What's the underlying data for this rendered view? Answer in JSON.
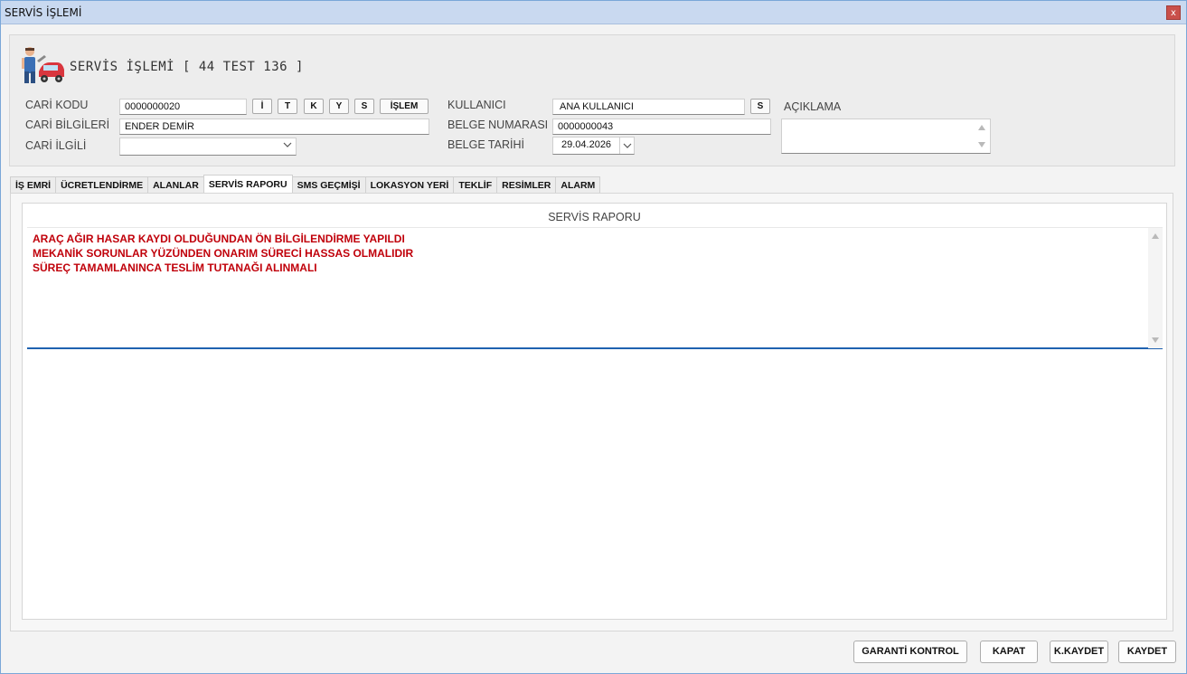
{
  "window": {
    "title": "SERVİS İŞLEMİ",
    "close_label": "x"
  },
  "header": {
    "title": "SERVİS İŞLEMİ [ 44 TEST 136 ]",
    "logo_icon": "mechanic-car-icon"
  },
  "form": {
    "cari_kodu": {
      "label": "CARİ KODU",
      "value": "0000000020"
    },
    "cari_bilgileri": {
      "label": "CARİ BİLGİLERİ",
      "value": "ENDER DEMİR"
    },
    "cari_ilgili": {
      "label": "CARİ İLGİLİ",
      "value": ""
    },
    "cari_buttons": [
      "İ",
      "T",
      "K",
      "Y",
      "S",
      "İŞLEM"
    ],
    "kullanici": {
      "label": "KULLANICI",
      "value": "ANA KULLANICI",
      "button": "S"
    },
    "belge_numarasi": {
      "label": "BELGE NUMARASI",
      "value": "0000000043"
    },
    "belge_tarihi": {
      "label": "BELGE TARİHİ",
      "value": "29.04.2026"
    },
    "aciklama": {
      "label": "AÇIKLAMA",
      "value": ""
    }
  },
  "tabs": [
    {
      "label": "İŞ EMRİ",
      "active": false
    },
    {
      "label": "ÜCRETLENDİRME",
      "active": false
    },
    {
      "label": "ALANLAR",
      "active": false
    },
    {
      "label": "SERVİS RAPORU",
      "active": true
    },
    {
      "label": "SMS GEÇMİŞİ",
      "active": false
    },
    {
      "label": "LOKASYON YERİ",
      "active": false
    },
    {
      "label": "TEKLİF",
      "active": false
    },
    {
      "label": "RESİMLER",
      "active": false
    },
    {
      "label": "ALARM",
      "active": false
    }
  ],
  "report": {
    "title": "SERVİS RAPORU",
    "lines": [
      "ARAÇ AĞIR HASAR KAYDI OLDUĞUNDAN ÖN BİLGİLENDİRME YAPILDI",
      "MEKANİK SORUNLAR YÜZÜNDEN ONARIM SÜRECİ HASSAS OLMALIDIR",
      "SÜREÇ TAMAMLANINCA TESLİM TUTANAĞI ALINMALI"
    ],
    "text_color": "#c0000a"
  },
  "footer_buttons": {
    "garanti": "GARANTİ KONTROL",
    "kapat": "KAPAT",
    "kkaydet": "K.KAYDET",
    "kaydet": "KAYDET"
  }
}
